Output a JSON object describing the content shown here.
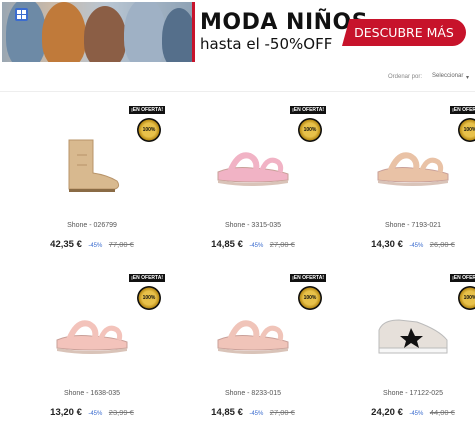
{
  "banner": {
    "title": "MODA NIÑOS",
    "subtitle": "hasta el -50%OFF",
    "cta": "DESCUBRE MÁS"
  },
  "toolbar": {
    "view_icon": "grid-view-icon",
    "sort_label": "Ordenar por:",
    "sort_value": "Seleccionar"
  },
  "products": [
    {
      "badge": "¡EN OFERTA!",
      "seal": "100%",
      "name": "Shone - 026799",
      "price": "42,35 €",
      "discount": "-45%",
      "old_price": "77,00 €",
      "color": "#d8b98f",
      "type": "boot"
    },
    {
      "badge": "¡EN OFERTA!",
      "seal": "100%",
      "name": "Shone - 3315-035",
      "price": "14,85 €",
      "discount": "-45%",
      "old_price": "27,00 €",
      "color": "#f1b3c5",
      "type": "sandal"
    },
    {
      "badge": "¡EN OFERTA!",
      "seal": "100%",
      "name": "Shone - 7193-021",
      "price": "14,30 €",
      "discount": "-45%",
      "old_price": "26,00 €",
      "color": "#e9c2a6",
      "type": "sandal"
    },
    {
      "badge": "¡EN OFERTA!",
      "seal": "100%",
      "name": "Shone - 1638-035",
      "price": "13,20 €",
      "discount": "-45%",
      "old_price": "23,99 €",
      "color": "#f3c3bb",
      "type": "sandal"
    },
    {
      "badge": "¡EN OFERTA!",
      "seal": "100%",
      "name": "Shone - 8233-015",
      "price": "14,85 €",
      "discount": "-45%",
      "old_price": "27,00 €",
      "color": "#f0c4b9",
      "type": "sandal"
    },
    {
      "badge": "¡EN OFERTA!",
      "seal": "100%",
      "name": "Shone - 17122-025",
      "price": "24,20 €",
      "discount": "-45%",
      "old_price": "44,00 €",
      "color": "#e6e0da",
      "type": "sneaker"
    }
  ]
}
